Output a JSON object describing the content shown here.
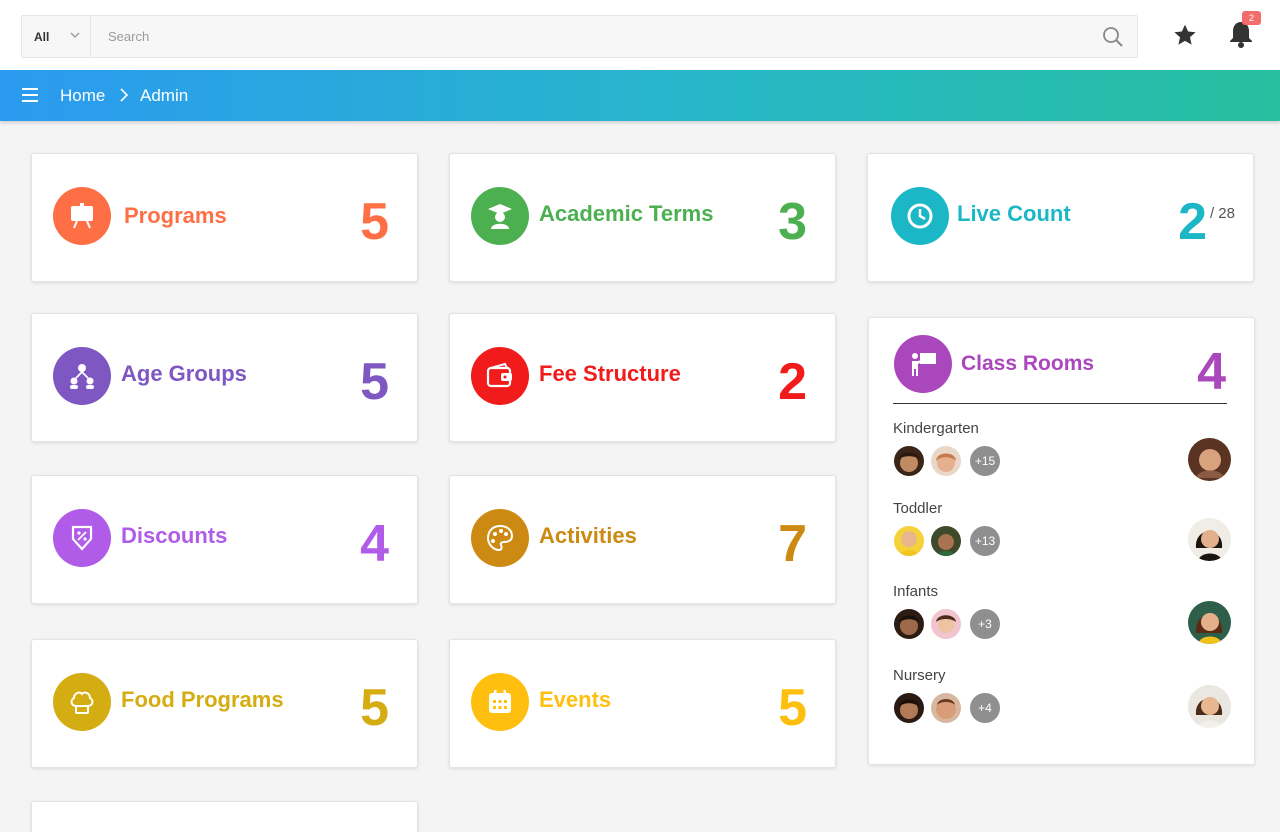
{
  "search": {
    "scope": "All",
    "placeholder": "Search"
  },
  "header": {
    "notification_count": "2"
  },
  "breadcrumb": {
    "home": "Home",
    "current": "Admin"
  },
  "colors": {
    "programs": "#ff6f45",
    "academic_terms": "#4caf50",
    "live_count": "#1bb7c6",
    "age_groups": "#7e57c2",
    "fee_structure": "#f21b1b",
    "discounts": "#b05ce8",
    "activities": "#cc8a12",
    "food_programs": "#d4ad12",
    "events": "#ffbf0f",
    "class_rooms": "#ab47bc"
  },
  "cards": {
    "programs": {
      "label": "Programs",
      "value": "5",
      "icon": "presentation-board-icon"
    },
    "academic_terms": {
      "label": "Academic Terms",
      "value": "3",
      "icon": "graduate-icon"
    },
    "live_count": {
      "label": "Live Count",
      "value": "2",
      "total": "/ 28",
      "icon": "clock-icon"
    },
    "age_groups": {
      "label": "Age Groups",
      "value": "5",
      "icon": "people-group-icon"
    },
    "fee_structure": {
      "label": "Fee Structure",
      "value": "2",
      "icon": "wallet-icon"
    },
    "discounts": {
      "label": "Discounts",
      "value": "4",
      "icon": "discount-tag-icon"
    },
    "activities": {
      "label": "Activities",
      "value": "7",
      "icon": "palette-icon"
    },
    "food_programs": {
      "label": "Food Programs",
      "value": "5",
      "icon": "chef-hat-icon"
    },
    "events": {
      "label": "Events",
      "value": "5",
      "icon": "calendar-icon"
    }
  },
  "class_rooms": {
    "label": "Class Rooms",
    "value": "4",
    "icon": "teacher-board-icon",
    "rooms": [
      {
        "name": "Kindergarten",
        "more": "+15"
      },
      {
        "name": "Toddler",
        "more": "+13"
      },
      {
        "name": "Infants",
        "more": "+3"
      },
      {
        "name": "Nursery",
        "more": "+4"
      }
    ]
  }
}
